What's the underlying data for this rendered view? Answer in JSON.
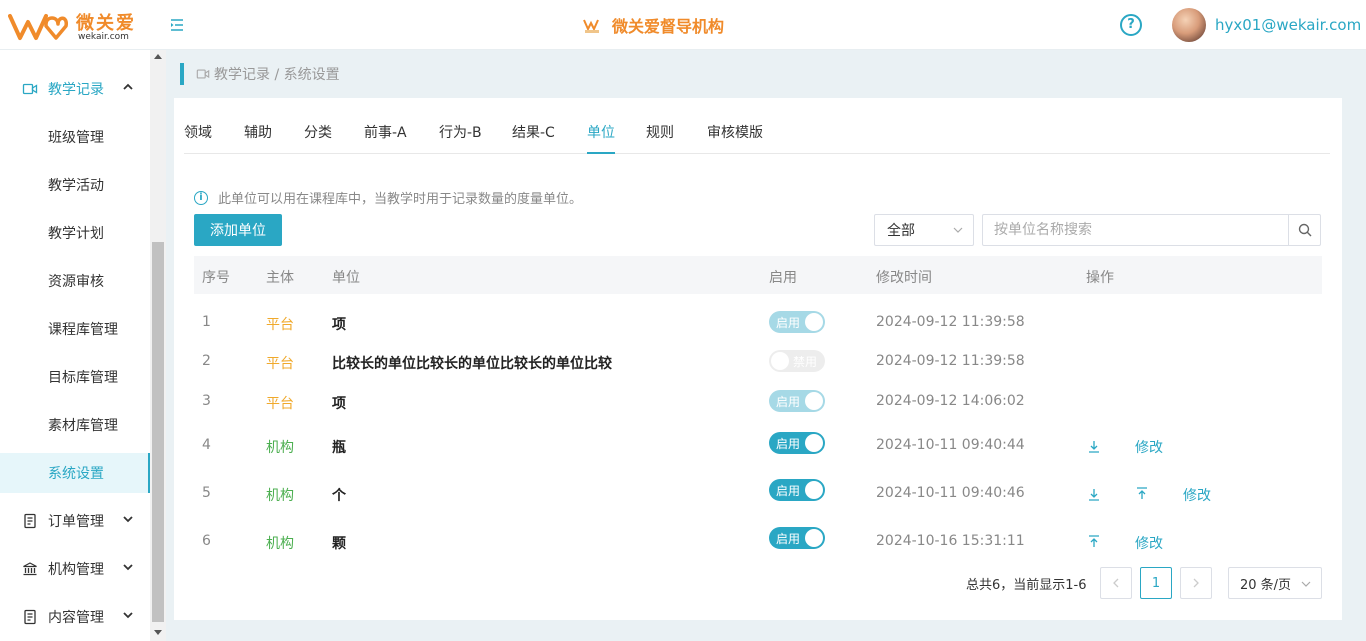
{
  "header": {
    "brand": "微关爱",
    "site": "wekair.com",
    "center_title": "微关爱督导机构",
    "user_email": "hyx01@wekair.com"
  },
  "sidebar": {
    "sections": [
      {
        "label": "教学记录",
        "icon": "video-icon",
        "expanded": true
      },
      {
        "label": "订单管理",
        "icon": "document-icon",
        "expanded": false
      },
      {
        "label": "机构管理",
        "icon": "bank-icon",
        "expanded": false
      },
      {
        "label": "内容管理",
        "icon": "document-icon",
        "expanded": false
      }
    ],
    "children": [
      "班级管理",
      "教学活动",
      "教学计划",
      "资源审核",
      "课程库管理",
      "目标库管理",
      "素材库管理",
      "系统设置"
    ],
    "active_child": "系统设置"
  },
  "breadcrumb": {
    "text": "教学记录 / 系统设置"
  },
  "tabs": [
    "领域",
    "辅助",
    "分类",
    "前事-A",
    "行为-B",
    "结果-C",
    "单位",
    "规则",
    "审核模版"
  ],
  "active_tab": "单位",
  "notice": "此单位可以用在课程库中，当教学时用于记录数量的度量单位。",
  "toolbar": {
    "add_label": "添加单位",
    "filter_value": "全部",
    "search_placeholder": "按单位名称搜索"
  },
  "table": {
    "headers": [
      "序号",
      "主体",
      "单位",
      "启用",
      "修改时间",
      "操作"
    ],
    "rows": [
      {
        "idx": "1",
        "owner": "平台",
        "owner_type": "platform",
        "unit": "项",
        "toggle": "启用",
        "enabled": true,
        "toggle_disabled": true,
        "time": "2024-09-12 11:39:58",
        "ops": []
      },
      {
        "idx": "2",
        "owner": "平台",
        "owner_type": "platform",
        "unit": "比较长的单位比较长的单位比较长的单位比较",
        "toggle": "禁用",
        "enabled": false,
        "toggle_disabled": true,
        "time": "2024-09-12 11:39:58",
        "ops": []
      },
      {
        "idx": "3",
        "owner": "平台",
        "owner_type": "platform",
        "unit": "项",
        "toggle": "启用",
        "enabled": true,
        "toggle_disabled": true,
        "time": "2024-09-12 14:06:02",
        "ops": []
      },
      {
        "idx": "4",
        "owner": "机构",
        "owner_type": "org",
        "unit": "瓶",
        "toggle": "启用",
        "enabled": true,
        "toggle_disabled": false,
        "time": "2024-10-11 09:40:44",
        "ops": [
          "move-down-icon",
          "修改"
        ]
      },
      {
        "idx": "5",
        "owner": "机构",
        "owner_type": "org",
        "unit": "个",
        "toggle": "启用",
        "enabled": true,
        "toggle_disabled": false,
        "time": "2024-10-11 09:40:46",
        "ops": [
          "move-down-icon",
          "move-to-top-icon",
          "修改"
        ]
      },
      {
        "idx": "6",
        "owner": "机构",
        "owner_type": "org",
        "unit": "颗",
        "toggle": "启用",
        "enabled": true,
        "toggle_disabled": false,
        "time": "2024-10-16 15:31:11",
        "ops": [
          "move-to-top-icon",
          "修改"
        ]
      }
    ]
  },
  "pagination": {
    "total_text": "总共6，当前显示1-6",
    "current_page": "1",
    "page_size": "20 条/页"
  },
  "colors": {
    "accent": "#2aa7c4",
    "brand_orange": "#f08b2b",
    "platform": "#f0a92b",
    "org": "#4caf50"
  }
}
